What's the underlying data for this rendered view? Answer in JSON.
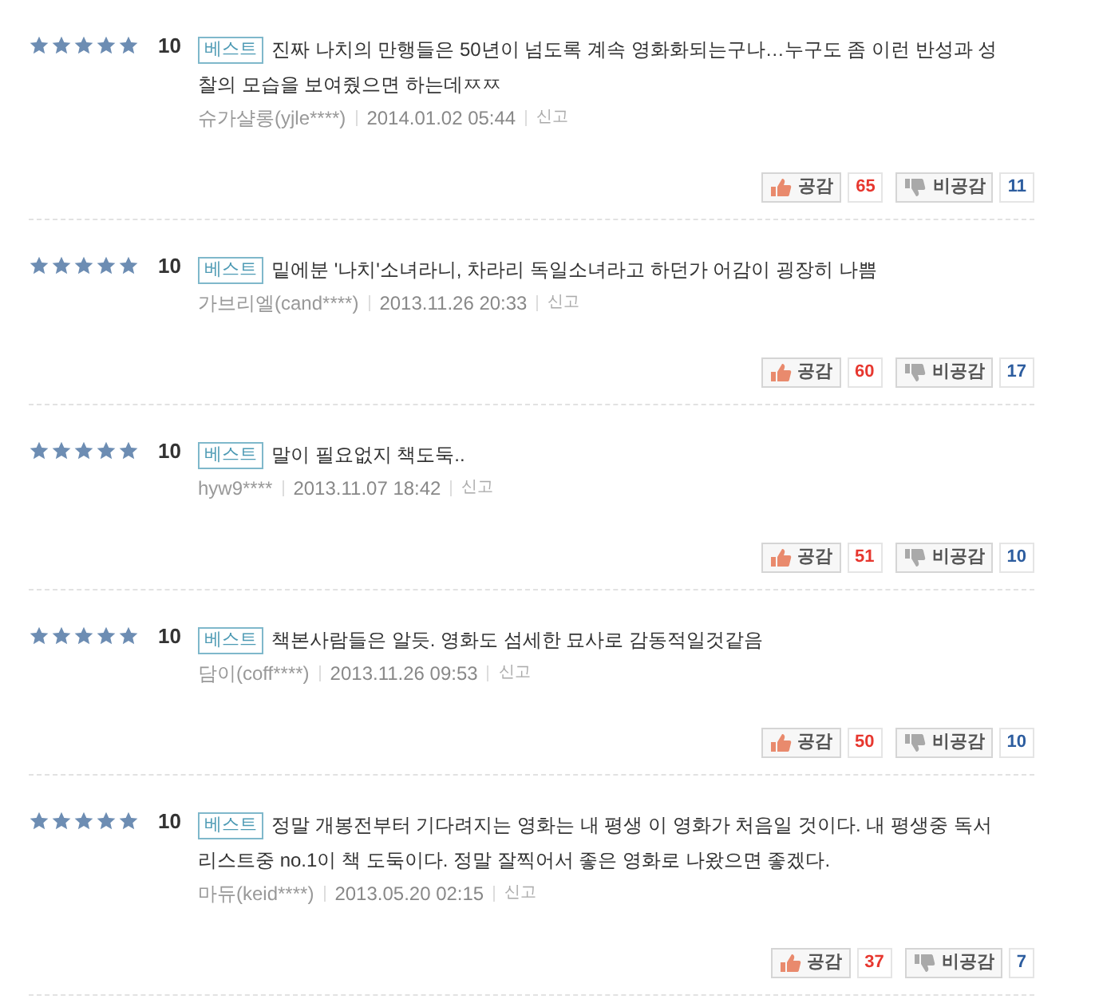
{
  "reviews": [
    {
      "stars": 5,
      "score": "10",
      "badge": "베스트",
      "lines": [
        "진짜 나치의 만행들은 50년이 넘도록 계속 영화화되는구나…누구도 좀 이런 반성과 성",
        "찰의 모습을 보여줬으면 하는데ㅉㅉ"
      ],
      "author": "슈가샬롱(yjle****)",
      "date": "2014.01.02 05:44",
      "report": "신고",
      "like_label": "공감",
      "likes": "65",
      "dislike_label": "비공감",
      "dislikes": "11"
    },
    {
      "stars": 5,
      "score": "10",
      "badge": "베스트",
      "lines": [
        "밑에분 '나치'소녀라니, 차라리 독일소녀라고 하던가 어감이 굉장히 나쁨"
      ],
      "author": "가브리엘(cand****)",
      "date": "2013.11.26 20:33",
      "report": "신고",
      "like_label": "공감",
      "likes": "60",
      "dislike_label": "비공감",
      "dislikes": "17"
    },
    {
      "stars": 5,
      "score": "10",
      "badge": "베스트",
      "lines": [
        "말이 필요없지 책도둑.."
      ],
      "author": "hyw9****",
      "date": "2013.11.07 18:42",
      "report": "신고",
      "like_label": "공감",
      "likes": "51",
      "dislike_label": "비공감",
      "dislikes": "10"
    },
    {
      "stars": 5,
      "score": "10",
      "badge": "베스트",
      "lines": [
        "책본사람들은 알듯. 영화도 섬세한 묘사로 감동적일것같음"
      ],
      "author": "담이(coff****)",
      "date": "2013.11.26 09:53",
      "report": "신고",
      "like_label": "공감",
      "likes": "50",
      "dislike_label": "비공감",
      "dislikes": "10"
    },
    {
      "stars": 5,
      "score": "10",
      "badge": "베스트",
      "lines": [
        "정말 개봉전부터 기다려지는 영화는 내 평생 이 영화가 처음일 것이다. 내 평생중 독서",
        "리스트중 no.1이 책 도둑이다. 정말 잘찍어서 좋은 영화로 나왔으면 좋겠다."
      ],
      "author": "마듀(keid****)",
      "date": "2013.05.20 02:15",
      "report": "신고",
      "like_label": "공감",
      "likes": "37",
      "dislike_label": "비공감",
      "dislikes": "7"
    }
  ]
}
